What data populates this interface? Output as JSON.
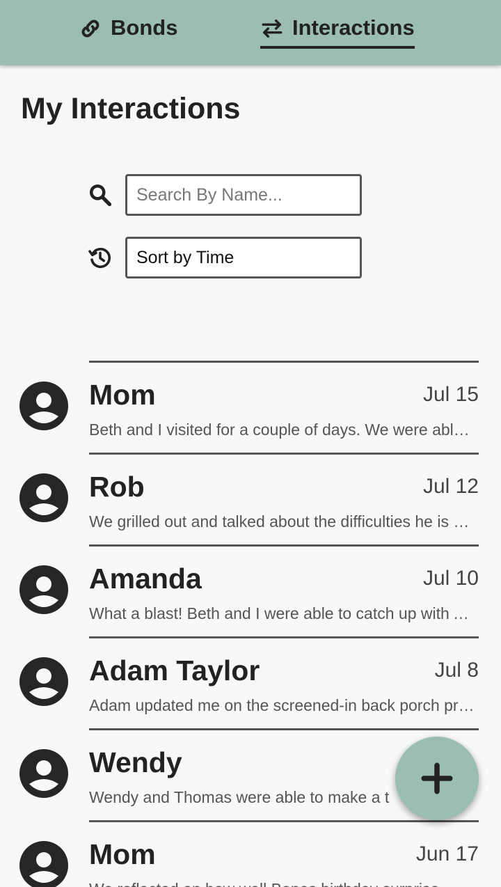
{
  "nav": {
    "tabs": [
      {
        "label": "Bonds",
        "icon": "link-icon",
        "active": false
      },
      {
        "label": "Interactions",
        "icon": "swap-arrows-icon",
        "active": true
      }
    ]
  },
  "page": {
    "title": "My Interactions"
  },
  "search": {
    "placeholder": "Search By Name...",
    "value": "",
    "icon": "search-icon"
  },
  "sort": {
    "selected": "Sort by Time",
    "icon": "history-icon"
  },
  "interactions": [
    {
      "name": "Mom",
      "date": "Jul 15",
      "summary": "Beth and I visited for a couple of days. We were able to catch up on everything going on"
    },
    {
      "name": "Rob",
      "date": "Jul 12",
      "summary": "We grilled out and talked about the difficulties he is having at work lately"
    },
    {
      "name": "Amanda",
      "date": "Jul 10",
      "summary": "What a blast! Beth and I were able to catch up with Amanda over dinner"
    },
    {
      "name": "Adam Taylor",
      "date": "Jul 8",
      "summary": "Adam updated me on the screened-in back porch project he is working on"
    },
    {
      "name": "Wendy",
      "date": "",
      "summary": "Wendy and Thomas were able to make a t"
    },
    {
      "name": "Mom",
      "date": "Jun 17",
      "summary": "We reflected on how well Banes birthday surprise"
    }
  ],
  "fab": {
    "icon": "plus-icon"
  },
  "colors": {
    "accent": "#9bbdb4",
    "background": "#f7f8fa",
    "text": "#222222"
  }
}
